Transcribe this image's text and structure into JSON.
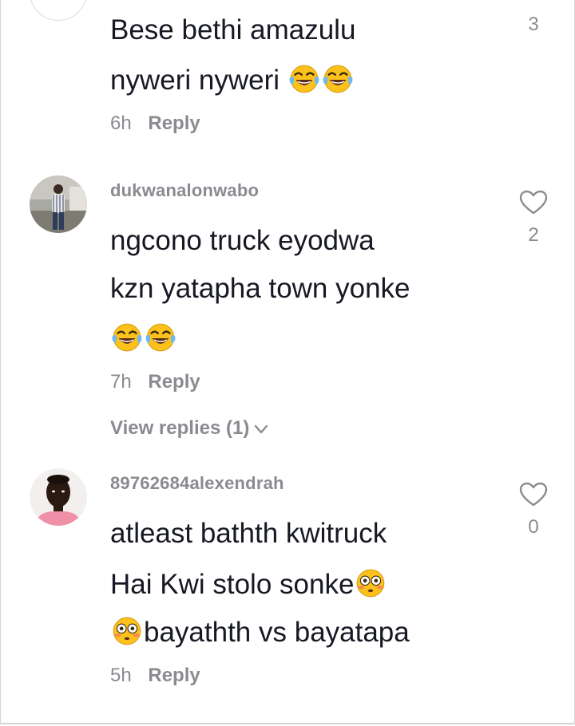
{
  "comments": [
    {
      "username": "",
      "lines": [
        "Bese bethi amazulu",
        "nyweri nyweri"
      ],
      "emojis_line2": [
        "face-with-tears-of-joy",
        "face-with-tears-of-joy"
      ],
      "time": "6h",
      "reply_label": "Reply",
      "like_count": "3"
    },
    {
      "username": "dukwanalonwabo",
      "lines": [
        "ngcono truck eyodwa",
        "kzn yatapha town yonke"
      ],
      "emojis_line3": [
        "face-with-tears-of-joy",
        "face-with-tears-of-joy"
      ],
      "time": "7h",
      "reply_label": "Reply",
      "view_replies_label": "View replies (1)",
      "like_count": "2",
      "avatar": "photo-of-man-standing-outdoors"
    },
    {
      "username": "89762684alexendrah",
      "lines": [
        "atleast bathth kwitruck",
        "Hai Kwi stolo sonke",
        "bayathth vs bayatapa"
      ],
      "emojis": [
        "flushed-face",
        "flushed-face"
      ],
      "time": "5h",
      "reply_label": "Reply",
      "like_count": "0",
      "avatar": "photo-of-person-portrait"
    }
  ],
  "colors": {
    "primary_text": "#161823",
    "secondary_text": "#8a8b91",
    "emoji_yellow": "#fcc21b"
  }
}
